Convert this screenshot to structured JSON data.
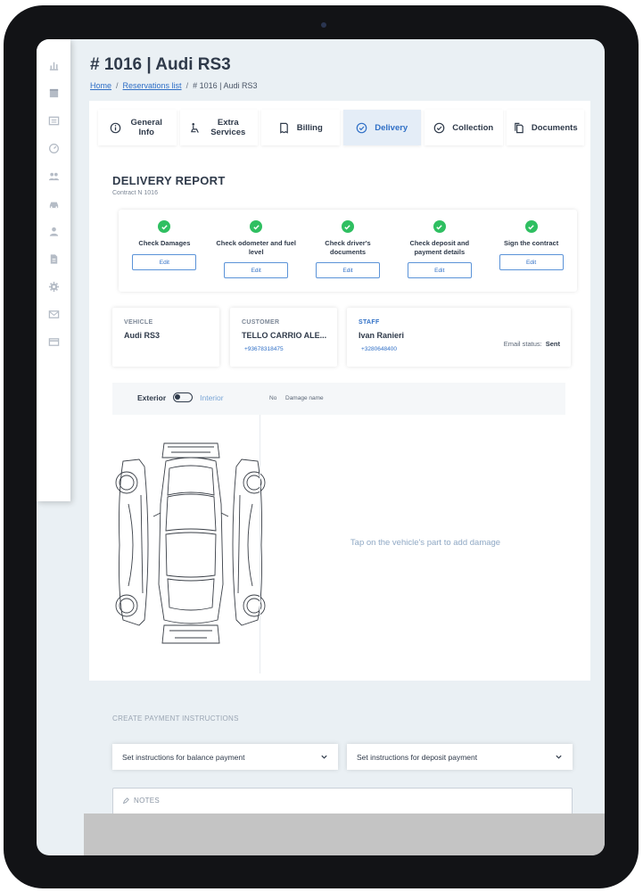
{
  "header": {
    "title": "# 1016 | Audi RS3",
    "breadcrumb": {
      "home": "Home",
      "list": "Reservations list",
      "current": "# 1016 | Audi RS3"
    }
  },
  "sidebar": {
    "icons": [
      "chart-icon",
      "calendar-icon",
      "list-icon",
      "speedometer-icon",
      "group-icon",
      "car-icon",
      "person-icon",
      "document-icon",
      "gear-icon",
      "mail-icon",
      "card-icon"
    ]
  },
  "tabs": [
    {
      "id": "general",
      "label": "General Info",
      "icon": "info-icon"
    },
    {
      "id": "extra",
      "label": "Extra Services",
      "icon": "seat-icon"
    },
    {
      "id": "billing",
      "label": "Billing",
      "icon": "receipt-icon"
    },
    {
      "id": "delivery",
      "label": "Delivery",
      "icon": "check-circle-icon",
      "active": true
    },
    {
      "id": "collection",
      "label": "Collection",
      "icon": "check-circle-icon"
    },
    {
      "id": "documents",
      "label": "Documents",
      "icon": "documents-icon"
    }
  ],
  "report": {
    "title": "DELIVERY REPORT",
    "contract": "Contract N 1016",
    "checks": [
      {
        "label": "Check Damages",
        "edit": "Edit"
      },
      {
        "label": "Check odometer and fuel level",
        "edit": "Edit"
      },
      {
        "label": "Check driver's documents",
        "edit": "Edit"
      },
      {
        "label": "Check deposit and payment details",
        "edit": "Edit"
      },
      {
        "label": "Sign the contract",
        "edit": "Edit"
      }
    ]
  },
  "vehicle": {
    "caption": "VEHICLE",
    "value": "Audi RS3"
  },
  "customer": {
    "caption": "CUSTOMER",
    "value": "TELLO CARRIO ALE...",
    "phone": "+93678318475"
  },
  "staff": {
    "caption": "STAFF",
    "value": "Ivan Ranieri",
    "phone": "+3280648400",
    "email_label": "Email status:",
    "email_value": "Sent"
  },
  "damage": {
    "exterior": "Exterior",
    "interior": "Interior",
    "col_no": "No",
    "col_name": "Damage name",
    "hint": "Tap on the vehicle's part to add damage"
  },
  "payment": {
    "caption": "CREATE PAYMENT INSTRUCTIONS",
    "balance": "Set instructions for balance payment",
    "deposit": "Set instructions for deposit payment"
  },
  "notes": {
    "caption": "NOTES"
  },
  "colors": {
    "accent": "#2f6fc6",
    "success": "#2fbf61",
    "text": "#2f3a4a",
    "tab_active_bg": "#e4edf7"
  }
}
